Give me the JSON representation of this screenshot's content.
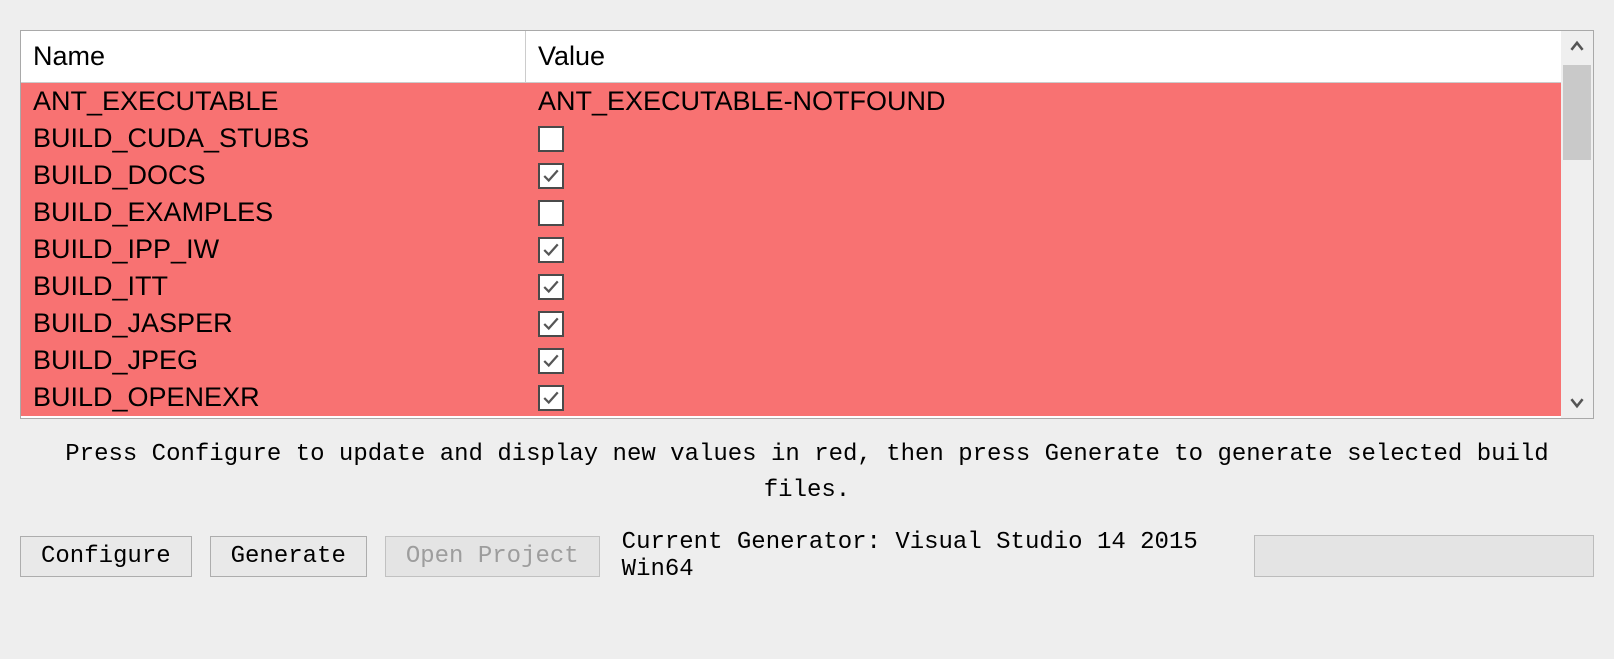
{
  "table": {
    "header": {
      "name": "Name",
      "value": "Value"
    },
    "rows": [
      {
        "name": "ANT_EXECUTABLE",
        "type": "text",
        "value": "ANT_EXECUTABLE-NOTFOUND"
      },
      {
        "name": "BUILD_CUDA_STUBS",
        "type": "checkbox",
        "checked": false
      },
      {
        "name": "BUILD_DOCS",
        "type": "checkbox",
        "checked": true
      },
      {
        "name": "BUILD_EXAMPLES",
        "type": "checkbox",
        "checked": false
      },
      {
        "name": "BUILD_IPP_IW",
        "type": "checkbox",
        "checked": true
      },
      {
        "name": "BUILD_ITT",
        "type": "checkbox",
        "checked": true
      },
      {
        "name": "BUILD_JASPER",
        "type": "checkbox",
        "checked": true
      },
      {
        "name": "BUILD_JPEG",
        "type": "checkbox",
        "checked": true
      },
      {
        "name": "BUILD_OPENEXR",
        "type": "checkbox",
        "checked": true
      }
    ]
  },
  "hint": "Press Configure to update and display new values in red, then press Generate to generate selected build files.",
  "buttons": {
    "configure": "Configure",
    "generate": "Generate",
    "open_project": "Open Project"
  },
  "generator_label": "Current Generator: Visual Studio 14 2015 Win64"
}
